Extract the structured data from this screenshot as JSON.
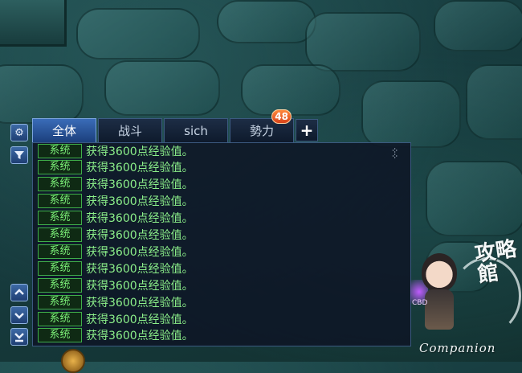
{
  "tabs": [
    {
      "label": "全体",
      "active": true
    },
    {
      "label": "战斗",
      "active": false
    },
    {
      "label": "sich",
      "active": false
    },
    {
      "label": "勢力",
      "active": false,
      "badge": "48"
    }
  ],
  "tab_add_icon": "plus-icon",
  "side_buttons": {
    "settings_icon": "gear-icon",
    "filter_icon": "filter-icon",
    "scroll_up_icon": "chevron-up-icon",
    "scroll_down_icon": "chevron-down-icon",
    "scroll_bottom_icon": "scroll-to-bottom-icon"
  },
  "messages": [
    {
      "channel": "系统",
      "text": "获得3600点经验值。"
    },
    {
      "channel": "系统",
      "text": "获得3600点经验值。"
    },
    {
      "channel": "系统",
      "text": "获得3600点经验值。"
    },
    {
      "channel": "系统",
      "text": "获得3600点经验值。"
    },
    {
      "channel": "系统",
      "text": "获得3600点经验值。"
    },
    {
      "channel": "系统",
      "text": "获得3600点经验值。"
    },
    {
      "channel": "系统",
      "text": "获得3600点经验值。"
    },
    {
      "channel": "系统",
      "text": "获得3600点经验值。"
    },
    {
      "channel": "系统",
      "text": "获得3600点经验值。"
    },
    {
      "channel": "系统",
      "text": "获得3600点经验值。"
    },
    {
      "channel": "系统",
      "text": "获得3600点经验值。"
    },
    {
      "channel": "系统",
      "text": "获得3600点经验值。"
    }
  ],
  "companion": {
    "label": "Companion",
    "logo_text": "攻略館",
    "chibi_text": "CBD"
  },
  "colors": {
    "system_tag_border": "#3fae49",
    "message_text": "#8cf08a",
    "active_tab": "#3a6cb8",
    "badge": "#e0561f"
  }
}
